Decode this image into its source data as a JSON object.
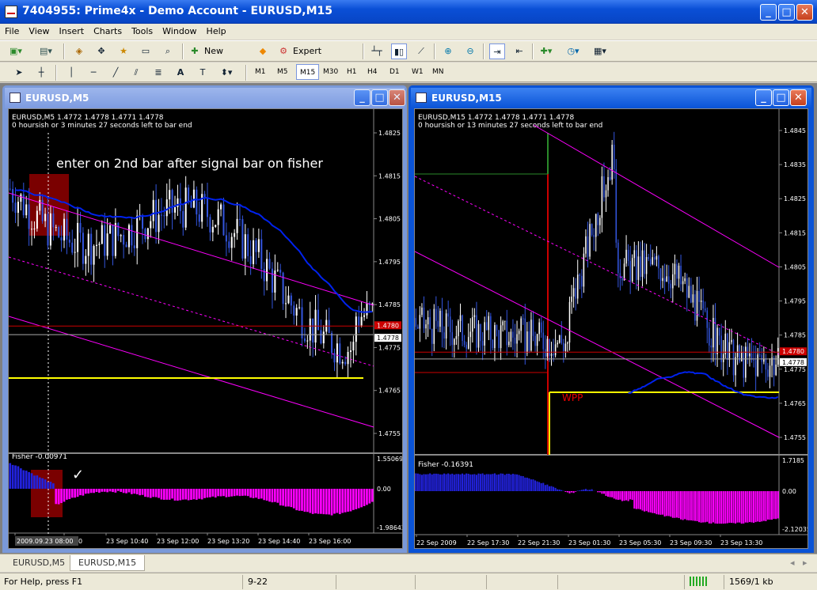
{
  "window": {
    "title": "7404955: Prime4x - Demo Account - EURUSD,M15"
  },
  "menu": [
    "File",
    "View",
    "Insert",
    "Charts",
    "Tools",
    "Window",
    "Help"
  ],
  "toolbar": {
    "new_order": "New Order",
    "expert_advisors": "Expert Advisors"
  },
  "drawing_tools": {
    "text_tool": "A"
  },
  "timeframes": [
    "M1",
    "M5",
    "M15",
    "M30",
    "H1",
    "H4",
    "D1",
    "W1",
    "MN"
  ],
  "active_timeframe": "M15",
  "chart_left": {
    "window_title": "EURUSD,M5",
    "info_line1": "EURUSD,M5  1.4772 1.4778 1.4771 1.4778",
    "info_line2": "0 hoursish or 3 minutes 27 seconds left to bar end",
    "annotation": "enter on 2nd bar after signal bar on fisher",
    "price_labels": [
      "1.4825",
      "1.4815",
      "1.4805",
      "1.4795",
      "1.4785",
      "1.4775",
      "1.4765",
      "1.4755"
    ],
    "bid_label": "1.4778",
    "ask_label": "1.4780",
    "fisher_label": "Fisher -0.00971",
    "fisher_scale": [
      "1.55069",
      "0.00",
      "-1.98642"
    ],
    "time_labels": [
      "2009.09.23 08:00",
      "09:20",
      "23 Sep 10:40",
      "23 Sep 12:00",
      "23 Sep 13:20",
      "23 Sep 14:40",
      "23 Sep 16:00"
    ],
    "checkmark": "✓"
  },
  "chart_right": {
    "window_title": "EURUSD,M15",
    "info_line1": "EURUSD,M15  1.4772 1.4778 1.4771 1.4778",
    "info_line2": "0 hoursish or 13 minutes 27 seconds left to bar end",
    "wpp_label": "WPP",
    "price_labels": [
      "1.4845",
      "1.4835",
      "1.4825",
      "1.4815",
      "1.4805",
      "1.4795",
      "1.4785",
      "1.4775",
      "1.4765",
      "1.4755"
    ],
    "bid_label": "1.4778",
    "ask_label": "1.4780",
    "fisher_label": "Fisher -0.16391",
    "fisher_scale": [
      "1.7185",
      "0.00",
      "-2.12035"
    ],
    "time_labels": [
      "22 Sep 2009",
      "22 Sep 17:30",
      "22 Sep 21:30",
      "23 Sep 01:30",
      "23 Sep 05:30",
      "23 Sep 09:30",
      "23 Sep 13:30"
    ]
  },
  "tabs": [
    "EURUSD,M5",
    "EURUSD,M15"
  ],
  "active_tab": "EURUSD,M15",
  "status": {
    "help": "For Help, press F1",
    "profile": "9-22",
    "traffic": "1569/1 kb"
  },
  "colors": {
    "bull": "#ffffff",
    "bear": "#3355dd",
    "ma": "#0022ee",
    "channel": "#ff00ff",
    "fisher_pos": "#2222dd",
    "fisher_neg": "#ff00ff",
    "pivot": "#ffff00"
  }
}
